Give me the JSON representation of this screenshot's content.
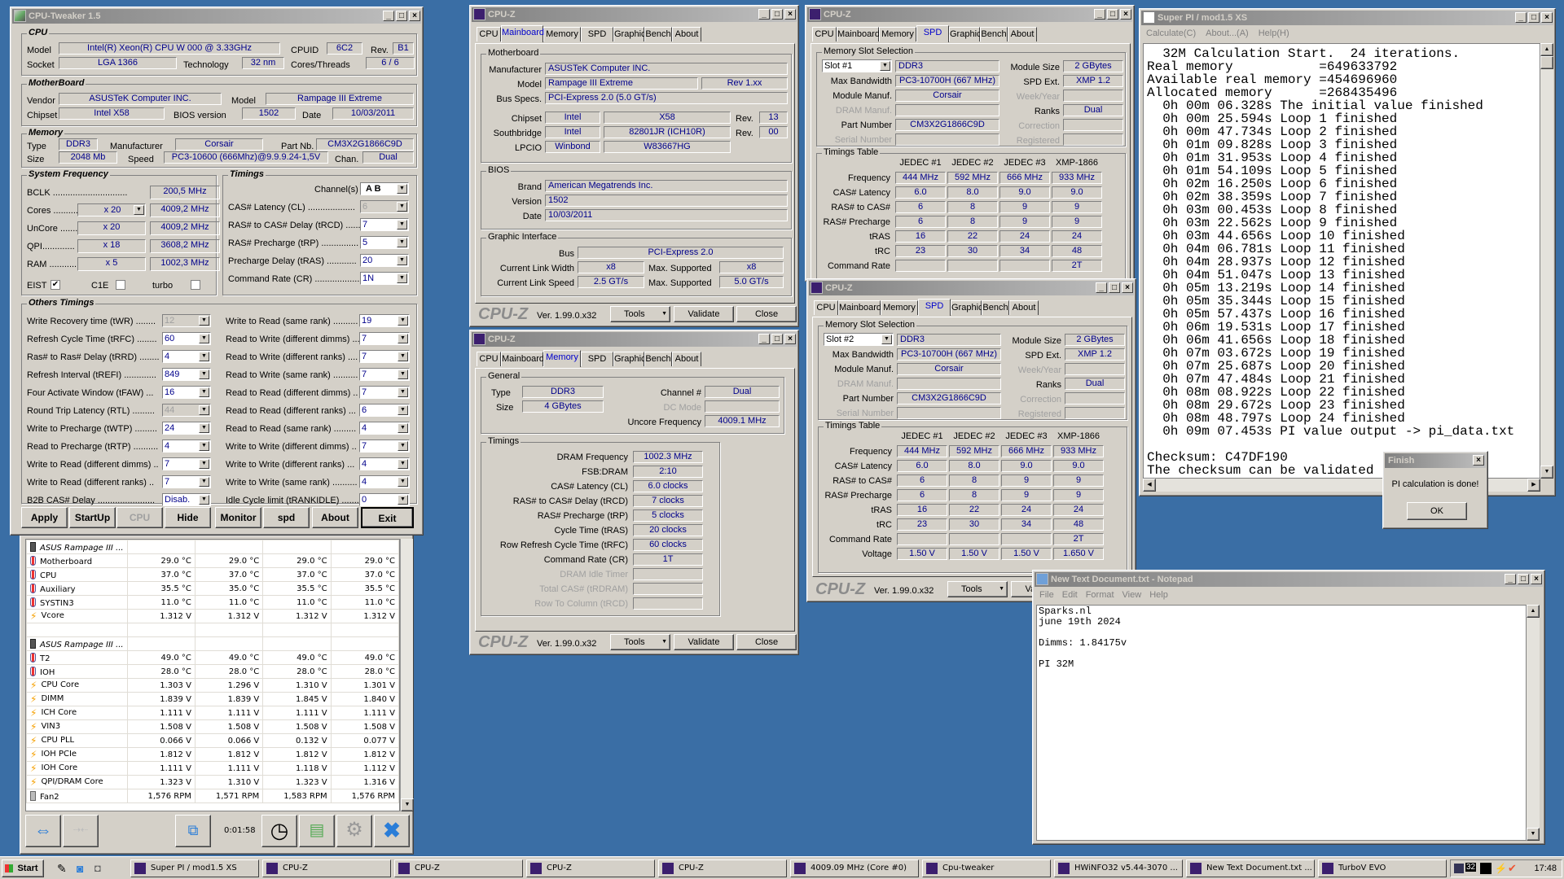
{
  "cputweaker": {
    "title": "CPU-Tweaker 1.5",
    "cpu": {
      "legend": "CPU",
      "model_label": "Model",
      "model": "Intel(R) Xeon(R) CPU       W 000  @ 3.33GHz",
      "cpuid_label": "CPUID",
      "cpuid": "6C2",
      "rev_label": "Rev.",
      "rev": "B1",
      "socket_label": "Socket",
      "socket": "LGA 1366",
      "tech_label": "Technology",
      "tech": "32 nm",
      "ct_label": "Cores/Threads",
      "ct": "6 / 6"
    },
    "mb": {
      "legend": "MotherBoard",
      "vendor_label": "Vendor",
      "vendor": "ASUSTeK Computer INC.",
      "model_label": "Model",
      "model": "Rampage III Extreme",
      "chipset_label": "Chipset",
      "chipset": "Intel X58",
      "bios_label": "BIOS version",
      "bios": "1502",
      "date_label": "Date",
      "date": "10/03/2011"
    },
    "mem": {
      "legend": "Memory",
      "type_label": "Type",
      "type": "DDR3",
      "manuf_label": "Manufacturer",
      "manuf": "Corsair",
      "part_label": "Part Nb.",
      "part": "CM3X2G1866C9D",
      "size_label": "Size",
      "size": "2048 Mb",
      "speed_label": "Speed",
      "speed": "PC3-10600 (666Mhz)@9.9.9.24-1,5V",
      "chan_label": "Chan.",
      "chan": "Dual"
    },
    "sysfreq": {
      "legend": "System Frequency",
      "bclk_label": "BCLK ..............................",
      "bclk": "200,5 MHz",
      "rows": [
        {
          "label": "Cores ............",
          "mult": "x 20",
          "freq": "4009,2 MHz"
        },
        {
          "label": "UnCore .........",
          "mult": "x 20",
          "freq": "4009,2 MHz"
        },
        {
          "label": "QPI.............",
          "mult": "x 18",
          "freq": "3608,2 MHz"
        },
        {
          "label": "RAM .............",
          "mult": "x 5",
          "freq": "1002,3 MHz"
        }
      ],
      "eist": "EIST",
      "c1e": "C1E",
      "turbo": "turbo",
      "eist_checked": true,
      "c1e_checked": false,
      "turbo_checked": false
    },
    "timings": {
      "legend": "Timings",
      "channel_label": "Channel(s)",
      "channel": "A  B",
      "rows": [
        {
          "label": "CAS# Latency (CL) ...................",
          "value": "6",
          "disabled": true
        },
        {
          "label": "RAS# to CAS# Delay (tRCD) ......",
          "value": "7"
        },
        {
          "label": "RAS# Precharge (tRP) ...............",
          "value": "5"
        },
        {
          "label": "Precharge Delay (tRAS) ............",
          "value": "20"
        },
        {
          "label": "Command Rate (CR) ..................",
          "value": "1N"
        }
      ]
    },
    "others": {
      "legend": "Others Timings",
      "left": [
        {
          "label": "Write Recovery time (tWR) ........",
          "value": "12",
          "disabled": true
        },
        {
          "label": "Refresh Cycle Time (tRFC) ........",
          "value": "60"
        },
        {
          "label": "Ras# to Ras# Delay (tRRD) ........",
          "value": "4"
        },
        {
          "label": "Refresh Interval (tREFI) .............",
          "value": "849"
        },
        {
          "label": "Four Activate Window (tFAW) ...",
          "value": "16"
        },
        {
          "label": "Round Trip Latency (RTL) .........",
          "value": "44",
          "disabled": true
        },
        {
          "label": "Write to Precharge (tWTP) .........",
          "value": "24"
        },
        {
          "label": "Read to Precharge (tRTP) ..........",
          "value": "4"
        },
        {
          "label": "Write to Read (different dimms) ..",
          "value": "7"
        },
        {
          "label": "Write to Read (different ranks) ..",
          "value": "7"
        },
        {
          "label": "B2B CAS# Delay .......................",
          "value": "Disab."
        }
      ],
      "right": [
        {
          "label": "Write to Read (same rank) ..........",
          "value": "19"
        },
        {
          "label": "Read to Write (different dimms) ...",
          "value": "7"
        },
        {
          "label": "Read to Write (different ranks) ....",
          "value": "7"
        },
        {
          "label": "Read to Write (same rank) ..........",
          "value": "7"
        },
        {
          "label": "Read to Read (different dimms) ..",
          "value": "7"
        },
        {
          "label": "Read to Read (different ranks) ...",
          "value": "6"
        },
        {
          "label": "Read to Read (same rank) .........",
          "value": "4"
        },
        {
          "label": "Write to Write (different dimms) ..",
          "value": "7"
        },
        {
          "label": "Write to Write (different ranks) ...",
          "value": "4"
        },
        {
          "label": "Write to Write (same rank) ..........",
          "value": "4"
        },
        {
          "label": "Idle Cycle limit (tRANKIDLE) ........",
          "value": "0"
        }
      ]
    },
    "buttons": [
      "Apply",
      "StartUp",
      "CPU",
      "Hide",
      "Monitor",
      "spd",
      "About",
      "Exit"
    ]
  },
  "hwinfo": {
    "groups": [
      {
        "name": "ASUS Rampage III ...",
        "rows": [
          {
            "icon": "temp",
            "name": "Motherboard",
            "v": [
              "29.0 °C",
              "29.0 °C",
              "29.0 °C",
              "29.0 °C"
            ]
          },
          {
            "icon": "temp",
            "name": "CPU",
            "v": [
              "37.0 °C",
              "37.0 °C",
              "37.0 °C",
              "37.0 °C"
            ]
          },
          {
            "icon": "temp",
            "name": "Auxiliary",
            "v": [
              "35.5 °C",
              "35.0 °C",
              "35.5 °C",
              "35.5 °C"
            ]
          },
          {
            "icon": "temp",
            "name": "SYSTIN3",
            "v": [
              "11.0 °C",
              "11.0 °C",
              "11.0 °C",
              "11.0 °C"
            ]
          },
          {
            "icon": "volt",
            "name": "Vcore",
            "v": [
              "1.312 V",
              "1.312 V",
              "1.312 V",
              "1.312 V"
            ]
          }
        ]
      },
      {
        "name": "ASUS Rampage III ...",
        "rows": [
          {
            "icon": "temp",
            "name": "T2",
            "v": [
              "49.0 °C",
              "49.0 °C",
              "49.0 °C",
              "49.0 °C"
            ]
          },
          {
            "icon": "temp",
            "name": "IOH",
            "v": [
              "28.0 °C",
              "28.0 °C",
              "28.0 °C",
              "28.0 °C"
            ]
          },
          {
            "icon": "volt",
            "name": "CPU Core",
            "v": [
              "1.303 V",
              "1.296 V",
              "1.310 V",
              "1.301 V"
            ]
          },
          {
            "icon": "volt",
            "name": "DIMM",
            "v": [
              "1.839 V",
              "1.839 V",
              "1.845 V",
              "1.840 V"
            ]
          },
          {
            "icon": "volt",
            "name": "ICH Core",
            "v": [
              "1.111 V",
              "1.111 V",
              "1.111 V",
              "1.111 V"
            ]
          },
          {
            "icon": "volt",
            "name": "VIN3",
            "v": [
              "1.508 V",
              "1.508 V",
              "1.508 V",
              "1.508 V"
            ]
          },
          {
            "icon": "volt",
            "name": "CPU PLL",
            "v": [
              "0.066 V",
              "0.066 V",
              "0.132 V",
              "0.077 V"
            ]
          },
          {
            "icon": "volt",
            "name": "IOH PCIe",
            "v": [
              "1.812 V",
              "1.812 V",
              "1.812 V",
              "1.812 V"
            ]
          },
          {
            "icon": "volt",
            "name": "IOH Core",
            "v": [
              "1.111 V",
              "1.111 V",
              "1.118 V",
              "1.112 V"
            ]
          },
          {
            "icon": "volt",
            "name": "QPI/DRAM Core",
            "v": [
              "1.323 V",
              "1.310 V",
              "1.323 V",
              "1.316 V"
            ]
          },
          {
            "icon": "fan",
            "name": "Fan2",
            "v": [
              "1,576 RPM",
              "1,571 RPM",
              "1,583 RPM",
              "1,576 RPM"
            ]
          }
        ]
      }
    ],
    "timer": "0:01:58"
  },
  "cpuz_tabs": [
    "CPU",
    "Mainboard",
    "Memory",
    "SPD",
    "Graphics",
    "Bench",
    "About"
  ],
  "cpuz_common": {
    "title": "CPU-Z",
    "logo": "CPU-Z",
    "version": "Ver. 1.99.0.x32",
    "tools": "Tools",
    "validate": "Validate",
    "close": "Close"
  },
  "cpuz_mb": {
    "mb_legend": "Motherboard",
    "manuf_label": "Manufacturer",
    "manuf": "ASUSTeK Computer INC.",
    "model_label": "Model",
    "model": "Rampage III Extreme",
    "model_rev": "Rev 1.xx",
    "bus_label": "Bus Specs.",
    "bus": "PCI-Express 2.0 (5.0 GT/s)",
    "chipset_label": "Chipset",
    "chipset_vendor": "Intel",
    "chipset": "X58",
    "rev_label": "Rev.",
    "chipset_rev": "13",
    "sb_label": "Southbridge",
    "sb_vendor": "Intel",
    "sb": "82801JR (ICH10R)",
    "sb_rev": "00",
    "lpcio_label": "LPCIO",
    "lpcio_vendor": "Winbond",
    "lpcio": "W83667HG",
    "bios_legend": "BIOS",
    "brand_label": "Brand",
    "brand": "American Megatrends Inc.",
    "version_label": "Version",
    "version": "1502",
    "date_label": "Date",
    "date": "10/03/2011",
    "gi_legend": "Graphic Interface",
    "bus2_label": "Bus",
    "bus2": "PCI-Express 2.0",
    "clw_label": "Current Link Width",
    "clw": "x8",
    "max_label": "Max. Supported",
    "mlw": "x8",
    "cls_label": "Current Link Speed",
    "cls": "2.5 GT/s",
    "mls": "5.0 GT/s"
  },
  "cpuz_mem": {
    "gen_legend": "General",
    "type_label": "Type",
    "type": "DDR3",
    "size_label": "Size",
    "size": "4 GBytes",
    "chan_label": "Channel #",
    "chan": "Dual",
    "dc_label": "DC Mode",
    "dc": "",
    "unc_label": "Uncore Frequency",
    "unc": "4009.1 MHz",
    "tim_legend": "Timings",
    "rows": [
      {
        "label": "DRAM Frequency",
        "value": "1002.3 MHz"
      },
      {
        "label": "FSB:DRAM",
        "value": "2:10"
      },
      {
        "label": "CAS# Latency (CL)",
        "value": "6.0 clocks"
      },
      {
        "label": "RAS# to CAS# Delay (tRCD)",
        "value": "7 clocks"
      },
      {
        "label": "RAS# Precharge (tRP)",
        "value": "5 clocks"
      },
      {
        "label": "Cycle Time (tRAS)",
        "value": "20 clocks"
      },
      {
        "label": "Row Refresh Cycle Time (tRFC)",
        "value": "60 clocks"
      },
      {
        "label": "Command Rate (CR)",
        "value": "1T"
      },
      {
        "label": "DRAM Idle Timer",
        "value": "",
        "gray": true
      },
      {
        "label": "Total CAS# (tRDRAM)",
        "value": "",
        "gray": true
      },
      {
        "label": "Row To Column (tRCD)",
        "value": "",
        "gray": true
      }
    ]
  },
  "cpuz_spd": [
    {
      "slot": "Slot #1",
      "type": "DDR3",
      "modsize": "2 GBytes",
      "maxbw": "PC3-10700H (667 MHz)",
      "spdext": "XMP 1.2",
      "manuf": "Corsair",
      "week": "",
      "dram": "",
      "ranks": "Dual",
      "part": "CM3X2G1866C9D",
      "corr": "",
      "serial": "",
      "reg": "",
      "show_voltage": false
    },
    {
      "slot": "Slot #2",
      "type": "DDR3",
      "modsize": "2 GBytes",
      "maxbw": "PC3-10700H (667 MHz)",
      "spdext": "XMP 1.2",
      "manuf": "Corsair",
      "week": "",
      "dram": "",
      "ranks": "Dual",
      "part": "CM3X2G1866C9D",
      "corr": "",
      "serial": "",
      "reg": "",
      "show_voltage": true
    }
  ],
  "spd_labels": {
    "slot_legend": "Memory Slot Selection",
    "maxbw": "Max Bandwidth",
    "manuf": "Module Manuf.",
    "dram": "DRAM Manuf.",
    "part": "Part Number",
    "serial": "Serial Number",
    "modsize": "Module Size",
    "spdext": "SPD Ext.",
    "week": "Week/Year",
    "ranks": "Ranks",
    "corr": "Correction",
    "reg": "Registered",
    "tt_legend": "Timings Table"
  },
  "spd_table": {
    "cols": [
      "JEDEC #1",
      "JEDEC #2",
      "JEDEC #3",
      "XMP-1866"
    ],
    "rows": [
      {
        "label": "Frequency",
        "v": [
          "444 MHz",
          "592 MHz",
          "666 MHz",
          "933 MHz"
        ]
      },
      {
        "label": "CAS# Latency",
        "v": [
          "6.0",
          "8.0",
          "9.0",
          "9.0"
        ]
      },
      {
        "label": "RAS# to CAS#",
        "v": [
          "6",
          "8",
          "9",
          "9"
        ]
      },
      {
        "label": "RAS# Precharge",
        "v": [
          "6",
          "8",
          "9",
          "9"
        ]
      },
      {
        "label": "tRAS",
        "v": [
          "16",
          "22",
          "24",
          "24"
        ]
      },
      {
        "label": "tRC",
        "v": [
          "23",
          "30",
          "34",
          "48"
        ]
      },
      {
        "label": "Command Rate",
        "v": [
          "",
          "",
          "",
          "2T"
        ]
      },
      {
        "label": "Voltage",
        "v": [
          "1.50 V",
          "1.50 V",
          "1.50 V",
          "1.650 V"
        ]
      }
    ]
  },
  "superpi": {
    "title": "Super PI / mod1.5 XS",
    "menu": [
      "Calculate(C)",
      "About...(A)",
      "Help(H)"
    ],
    "lines": [
      "  32M Calculation Start.  24 iterations.",
      "Real memory           =649633792",
      "Available real memory =454696960",
      "Allocated memory      =268435496",
      "  0h 00m 06.328s The initial value finished",
      "  0h 00m 25.594s Loop 1 finished",
      "  0h 00m 47.734s Loop 2 finished",
      "  0h 01m 09.828s Loop 3 finished",
      "  0h 01m 31.953s Loop 4 finished",
      "  0h 01m 54.109s Loop 5 finished",
      "  0h 02m 16.250s Loop 6 finished",
      "  0h 02m 38.359s Loop 7 finished",
      "  0h 03m 00.453s Loop 8 finished",
      "  0h 03m 22.562s Loop 9 finished",
      "  0h 03m 44.656s Loop 10 finished",
      "  0h 04m 06.781s Loop 11 finished",
      "  0h 04m 28.937s Loop 12 finished",
      "  0h 04m 51.047s Loop 13 finished",
      "  0h 05m 13.219s Loop 14 finished",
      "  0h 05m 35.344s Loop 15 finished",
      "  0h 05m 57.437s Loop 16 finished",
      "  0h 06m 19.531s Loop 17 finished",
      "  0h 06m 41.656s Loop 18 finished",
      "  0h 07m 03.672s Loop 19 finished",
      "  0h 07m 25.687s Loop 20 finished",
      "  0h 07m 47.484s Loop 21 finished",
      "  0h 08m 08.922s Loop 22 finished",
      "  0h 08m 29.672s Loop 23 finished",
      "  0h 08m 48.797s Loop 24 finished",
      "  0h 09m 07.453s PI value output -> pi_data.txt",
      "",
      "Checksum: C47DF190",
      "The checksum can be validated at"
    ]
  },
  "finish": {
    "title": "Finish",
    "message": "PI calculation is done!",
    "ok": "OK"
  },
  "notepad": {
    "title": "New Text Document.txt - Notepad",
    "menu": [
      "File",
      "Edit",
      "Format",
      "View",
      "Help"
    ],
    "text": "Sparks.nl\njune 19th 2024\n\nDimms: 1.84175v\n\nPI 32M"
  },
  "taskbar": {
    "start": "Start",
    "items": [
      "Super PI / mod1.5 XS",
      "CPU-Z",
      "CPU-Z",
      "CPU-Z",
      "CPU-Z",
      "4009.09 MHz (Core #0)",
      "Cpu-tweaker",
      "HWiNFO32 v5.44-3070 ...",
      "New Text Document.txt ...",
      "TurboV EVO"
    ],
    "tray_num": "32",
    "clock": "17:48"
  }
}
